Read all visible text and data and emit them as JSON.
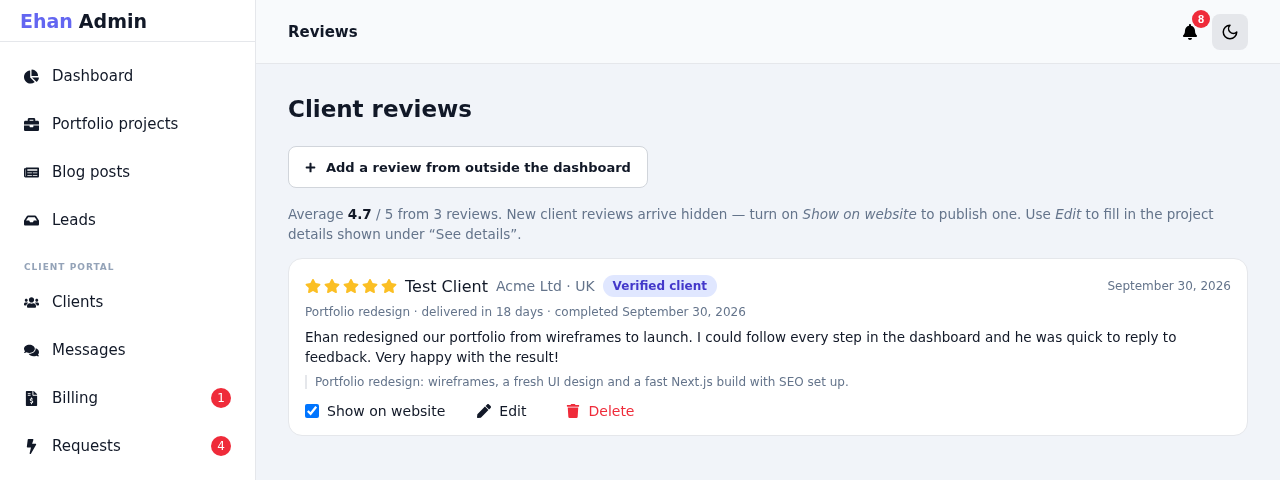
{
  "brand": {
    "first": "Ehan",
    "second": "Admin"
  },
  "sidebar": {
    "items": [
      {
        "kind": "link",
        "label": "Dashboard"
      },
      {
        "kind": "link",
        "label": "Portfolio projects"
      },
      {
        "kind": "link",
        "label": "Blog posts"
      },
      {
        "kind": "link",
        "label": "Leads"
      },
      {
        "kind": "heading",
        "label": "CLIENT PORTAL"
      },
      {
        "kind": "link",
        "label": "Clients"
      },
      {
        "kind": "link",
        "label": "Messages"
      },
      {
        "kind": "link",
        "label": "Billing",
        "badge": "1"
      },
      {
        "kind": "link",
        "label": "Requests",
        "badge": "4"
      }
    ]
  },
  "header": {
    "title": "Reviews",
    "notifications": "8"
  },
  "page": {
    "title": "Client reviews",
    "add_button": "Add a review from outside the dashboard",
    "summary": "Average **4.7** / 5 from 3 reviews. New client reviews arrive hidden — turn on *Show on website* to publish one. Use *Edit* to fill in the project details shown under “See details”."
  },
  "reviews": [
    {
      "stars": 5,
      "name": "Test Client",
      "company": "Acme Ltd · UK",
      "badge": "Verified client",
      "date": "September 30, 2026",
      "meta": "Portfolio redesign · delivered in 18 days · completed September 30, 2026",
      "text": "Ehan redesigned our portfolio from wireframes to launch. I could follow every step in the dashboard and he was quick to reply to feedback. Very happy with the result!",
      "project": "Portfolio redesign: wireframes, a fresh UI design and a fast Next.js build with SEO set up.",
      "show_on_website": {
        "label": "Show on website",
        "checked": true
      },
      "edit": "Edit",
      "delete": "Delete"
    }
  ]
}
